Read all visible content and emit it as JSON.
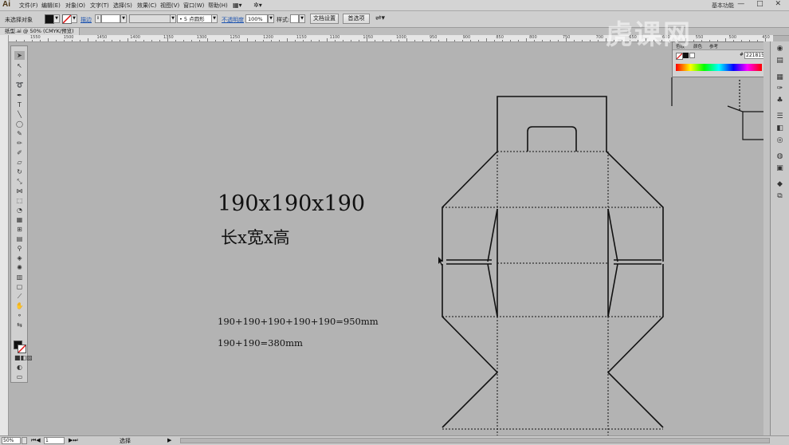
{
  "app": {
    "logo": "Ai",
    "menus": [
      "文件(F)",
      "编辑(E)",
      "对象(O)",
      "文字(T)",
      "选择(S)",
      "效果(C)",
      "视图(V)",
      "窗口(W)",
      "帮助(H)"
    ],
    "workspace": "基本功能",
    "window_controls": "— □ ✕"
  },
  "control_bar": {
    "selection_label": "未选择对象",
    "stroke_label": "描边",
    "stroke_style": "5 点圆形",
    "opacity_label": "不透明度",
    "opacity_value": "100%",
    "style_label": "样式:",
    "doc_setup_button": "文档设置",
    "preferences_button": "首选项"
  },
  "document": {
    "tab_title": "纸型.ai @ 50% (CMYK/预览)"
  },
  "ruler": {
    "labels": [
      "1550",
      "1500",
      "1450",
      "1400",
      "1350",
      "1300",
      "1250",
      "1200",
      "1150",
      "1100",
      "1050",
      "1000",
      "950",
      "900",
      "850",
      "800",
      "750",
      "700",
      "650",
      "600",
      "550",
      "500",
      "450"
    ]
  },
  "canvas": {
    "dimension_heading": "190x190x190",
    "dimension_subheading": "长x宽x高",
    "length_formula": "190+190+190+190+190=950mm",
    "width_formula": "190+190=380mm"
  },
  "color_panel": {
    "tab_1": "色板",
    "tab_2": "颜色",
    "tab_3": "参考",
    "hex_value": "221815"
  },
  "status_bar": {
    "zoom": "50%",
    "artboard": "1",
    "tool_name": "选择"
  },
  "watermark": "虎课网"
}
